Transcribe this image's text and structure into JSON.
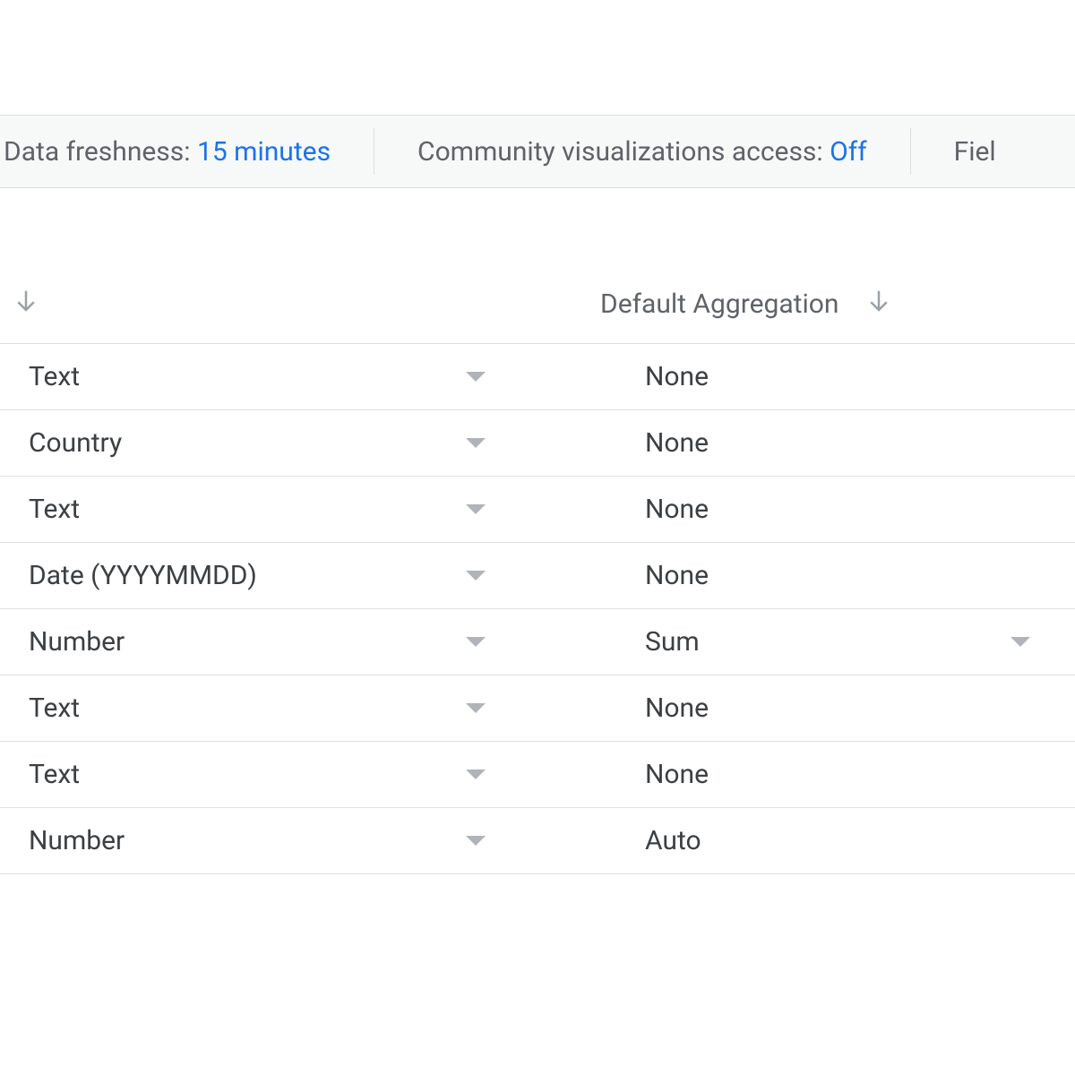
{
  "status_bar": {
    "freshness_label": "Data freshness: ",
    "freshness_value": "15 minutes",
    "community_label": "Community visualizations access: ",
    "community_value": "Off",
    "field_label_partial": "Fiel"
  },
  "table": {
    "headers": {
      "type": "",
      "aggregation": "Default Aggregation"
    },
    "rows": [
      {
        "type": "Text",
        "aggregation": "None",
        "agg_dropdown": false
      },
      {
        "type": "Country",
        "aggregation": "None",
        "agg_dropdown": false
      },
      {
        "type": "Text",
        "aggregation": "None",
        "agg_dropdown": false
      },
      {
        "type": "Date (YYYYMMDD)",
        "aggregation": "None",
        "agg_dropdown": false
      },
      {
        "type": "Number",
        "aggregation": "Sum",
        "agg_dropdown": true
      },
      {
        "type": "Text",
        "aggregation": "None",
        "agg_dropdown": false
      },
      {
        "type": "Text",
        "aggregation": "None",
        "agg_dropdown": false
      },
      {
        "type": "Number",
        "aggregation": "Auto",
        "agg_dropdown": false
      }
    ]
  }
}
